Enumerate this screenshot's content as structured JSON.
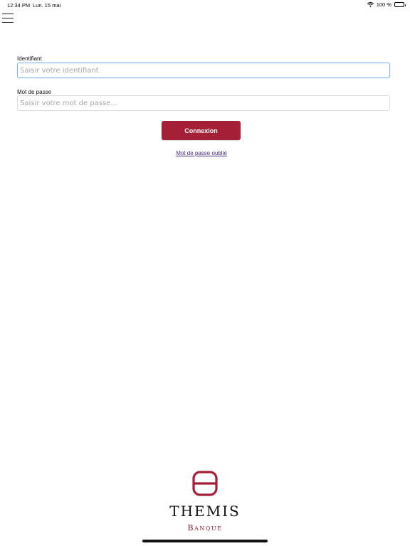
{
  "status_bar": {
    "time": "12:34 PM",
    "date": "Lun. 15 mai",
    "battery_text": "100 %",
    "wifi_icon": "wifi-icon",
    "battery_icon": "battery-icon"
  },
  "menu": {
    "icon": "hamburger-menu-icon"
  },
  "login_form": {
    "username": {
      "label": "Identifiant",
      "placeholder": "Saisir votre identifiant",
      "value": ""
    },
    "password": {
      "label": "Mot de passe",
      "placeholder": "Saisir votre mot de passe...",
      "value": ""
    },
    "submit_label": "Connexion",
    "forgot_password_label": "Mot de passe oublié"
  },
  "brand": {
    "name": "THEMIS",
    "subtitle": "Banque",
    "color": "#a51f37"
  },
  "colors": {
    "accent": "#a51f37",
    "link": "#4a2b83",
    "focus_border": "#7fb4e8"
  }
}
